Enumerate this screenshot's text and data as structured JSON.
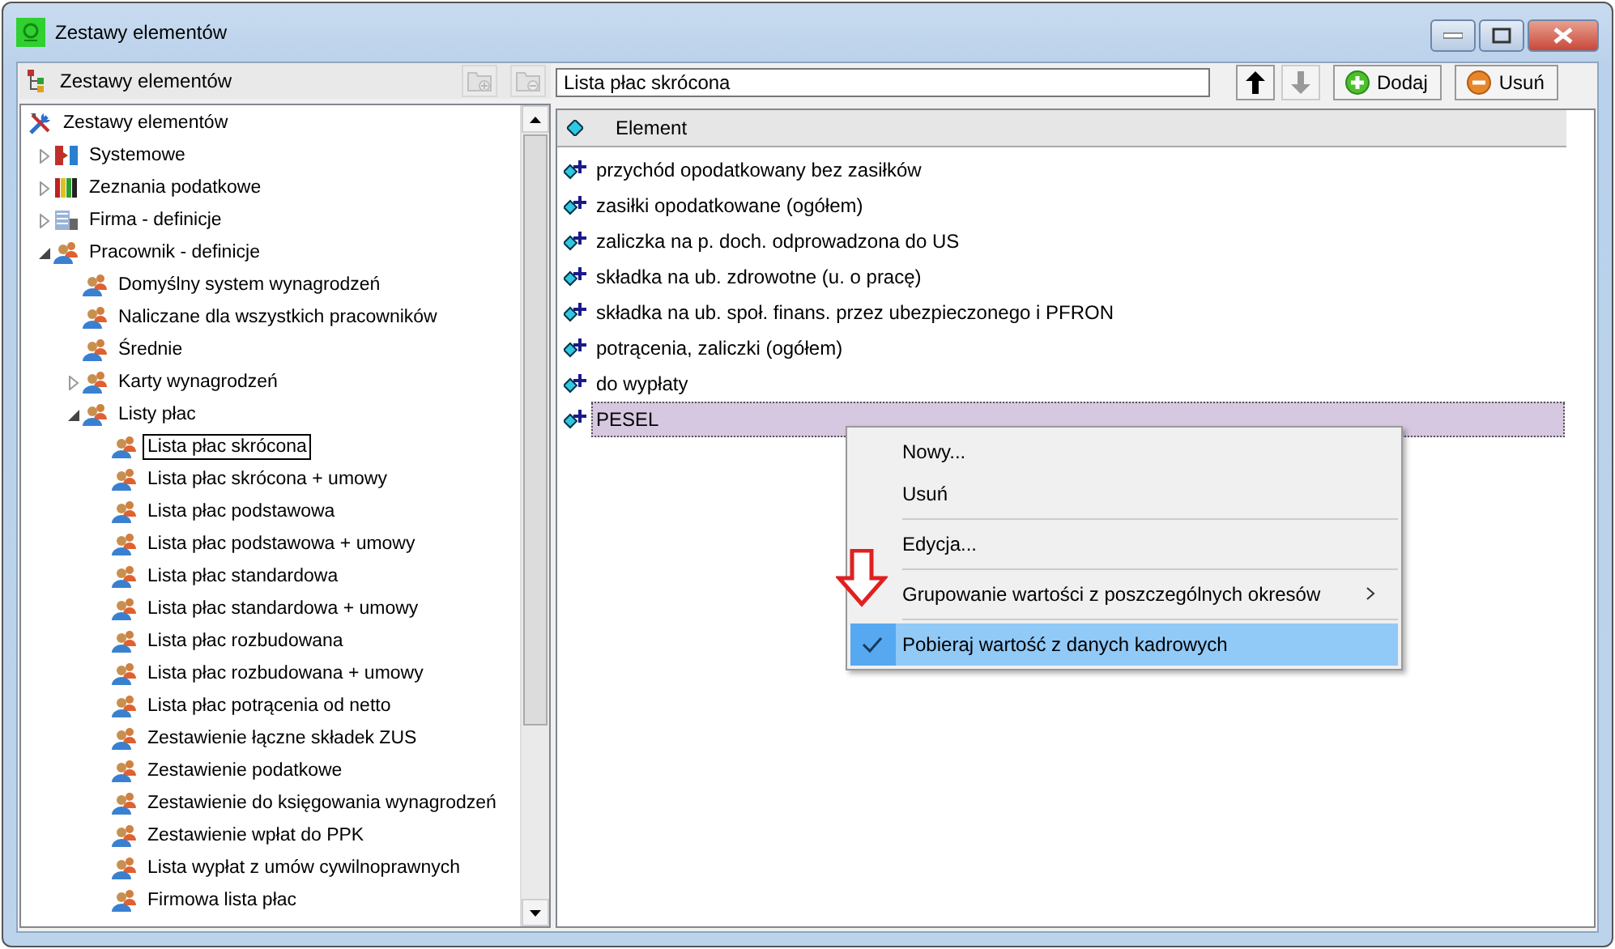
{
  "window": {
    "title": "Zestawy elementów"
  },
  "left_toolbar": {
    "title": "Zestawy elementów",
    "buttons": [
      {
        "kind": "folder-add",
        "disabled": true
      },
      {
        "kind": "folder-remove",
        "disabled": true
      }
    ]
  },
  "tree": {
    "label": "Zestawy elementów",
    "kind": "tools",
    "selected": false,
    "children": [
      {
        "label": "Systemowe",
        "kind": "system",
        "expanded": false,
        "selected": false
      },
      {
        "label": "Zeznania podatkowe",
        "kind": "binders",
        "expanded": false,
        "selected": false
      },
      {
        "label": "Firma - definicje",
        "kind": "building",
        "expanded": false,
        "selected": false
      },
      {
        "label": "Pracownik - definicje",
        "kind": "people",
        "expanded": true,
        "selected": false,
        "children": [
          {
            "label": "Domyślny system wynagrodzeń",
            "kind": "people",
            "selected": false
          },
          {
            "label": "Naliczane dla wszystkich pracowników",
            "kind": "people",
            "selected": false
          },
          {
            "label": "Średnie",
            "kind": "people",
            "selected": false
          },
          {
            "label": "Karty wynagrodzeń",
            "kind": "people",
            "expanded": false,
            "selected": false
          },
          {
            "label": "Listy płac",
            "kind": "people",
            "expanded": true,
            "selected": false,
            "children": [
              {
                "label": "Lista płac skrócona",
                "kind": "people",
                "selected": true
              },
              {
                "label": "Lista płac skrócona + umowy",
                "kind": "people",
                "selected": false
              },
              {
                "label": "Lista płac podstawowa",
                "kind": "people",
                "selected": false
              },
              {
                "label": "Lista płac podstawowa + umowy",
                "kind": "people",
                "selected": false
              },
              {
                "label": "Lista płac standardowa",
                "kind": "people",
                "selected": false
              },
              {
                "label": "Lista płac standardowa + umowy",
                "kind": "people",
                "selected": false
              },
              {
                "label": "Lista płac rozbudowana",
                "kind": "people",
                "selected": false
              },
              {
                "label": "Lista płac rozbudowana + umowy",
                "kind": "people",
                "selected": false
              },
              {
                "label": "Lista płac potrącenia od netto",
                "kind": "people",
                "selected": false
              },
              {
                "label": "Zestawienie łączne składek ZUS",
                "kind": "people",
                "selected": false
              },
              {
                "label": "Zestawienie podatkowe",
                "kind": "people",
                "selected": false
              },
              {
                "label": "Zestawienie do księgowania wynagrodzeń",
                "kind": "people",
                "selected": false
              },
              {
                "label": "Zestawienie wpłat do PPK",
                "kind": "people",
                "selected": false
              },
              {
                "label": "Lista wypłat z umów cywilnoprawnych",
                "kind": "people",
                "selected": false
              },
              {
                "label": "Firmowa lista płac",
                "kind": "people",
                "selected": false
              }
            ]
          }
        ]
      }
    ]
  },
  "name_field": {
    "value": "Lista płac skrócona"
  },
  "move_buttons": [
    {
      "kind": "up",
      "disabled": false
    },
    {
      "kind": "down",
      "disabled": true
    }
  ],
  "action_buttons": [
    {
      "kind": "add",
      "label": "Dodaj"
    },
    {
      "kind": "remove",
      "label": "Usuń"
    }
  ],
  "table": {
    "columns": [
      "Element"
    ],
    "rows": [
      {
        "label": "przychód opodatkowany bez zasiłków",
        "selected": false
      },
      {
        "label": "zasiłki opodatkowane (ogółem)",
        "selected": false
      },
      {
        "label": "zaliczka na p. doch. odprowadzona do US",
        "selected": false
      },
      {
        "label": "składka na ub. zdrowotne (u. o pracę)",
        "selected": false
      },
      {
        "label": "składka na ub. społ. finans. przez ubezpieczonego i PFRON",
        "selected": false
      },
      {
        "label": "potrącenia, zaliczki (ogółem)",
        "selected": false
      },
      {
        "label": "do wypłaty",
        "selected": false
      },
      {
        "label": "PESEL",
        "selected": true
      }
    ]
  },
  "context_menu": {
    "items": [
      {
        "kind": "item",
        "label": "Nowy...",
        "checked": false,
        "highlighted": false,
        "submenu": false
      },
      {
        "kind": "item",
        "label": "Usuń",
        "checked": false,
        "highlighted": false,
        "submenu": false
      },
      {
        "kind": "separator"
      },
      {
        "kind": "item",
        "label": "Edycja...",
        "checked": false,
        "highlighted": false,
        "submenu": false
      },
      {
        "kind": "separator"
      },
      {
        "kind": "item",
        "label": "Grupowanie wartości z poszczególnych okresów",
        "checked": false,
        "highlighted": false,
        "submenu": true
      },
      {
        "kind": "separator"
      },
      {
        "kind": "item",
        "label": "Pobieraj wartość z danych kadrowych",
        "checked": true,
        "highlighted": true,
        "submenu": false
      }
    ]
  }
}
